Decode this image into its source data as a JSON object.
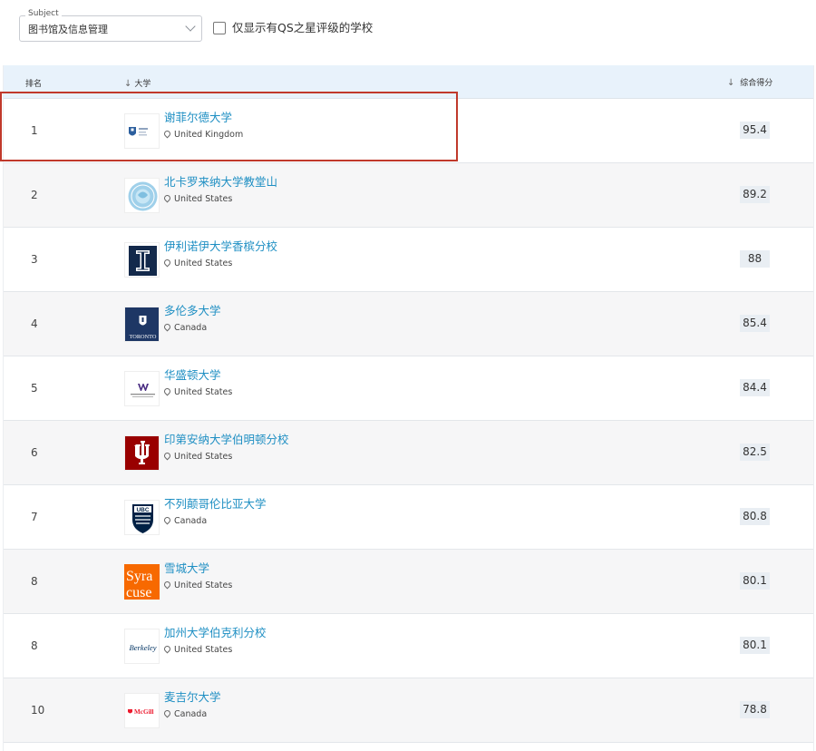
{
  "filter": {
    "subject_legend": "Subject",
    "subject_value": "图书馆及信息管理",
    "qs_stars_label": "仅显示有QS之星评级的学校"
  },
  "table": {
    "headers": {
      "rank": "排名",
      "university": "大学",
      "score": "综合得分"
    },
    "rows": [
      {
        "rank": "1",
        "name": "谢菲尔德大学",
        "country": "United Kingdom",
        "score": "95.4",
        "logo": "sheffield-logo"
      },
      {
        "rank": "2",
        "name": "北卡罗来纳大学教堂山",
        "country": "United States",
        "score": "89.2",
        "logo": "unc-seal-logo"
      },
      {
        "rank": "3",
        "name": "伊利诺伊大学香槟分校",
        "country": "United States",
        "score": "88",
        "logo": "illinois-i-logo"
      },
      {
        "rank": "4",
        "name": "多伦多大学",
        "country": "Canada",
        "score": "85.4",
        "logo": "toronto-logo"
      },
      {
        "rank": "5",
        "name": "华盛顿大学",
        "country": "United States",
        "score": "84.4",
        "logo": "uw-logo"
      },
      {
        "rank": "6",
        "name": "印第安纳大学伯明顿分校",
        "country": "United States",
        "score": "82.5",
        "logo": "indiana-logo"
      },
      {
        "rank": "7",
        "name": "不列颠哥伦比亚大学",
        "country": "Canada",
        "score": "80.8",
        "logo": "ubc-logo"
      },
      {
        "rank": "8",
        "name": "雪城大学",
        "country": "United States",
        "score": "80.1",
        "logo": "syracuse-logo"
      },
      {
        "rank": "8",
        "name": "加州大学伯克利分校",
        "country": "United States",
        "score": "80.1",
        "logo": "berkeley-logo"
      },
      {
        "rank": "10",
        "name": "麦吉尔大学",
        "country": "Canada",
        "score": "78.8",
        "logo": "mcgill-logo"
      }
    ]
  },
  "logo_text": {
    "toronto": "TORONTO",
    "ubc": "UBC",
    "syracuse_top": "Syra",
    "syracuse_bottom": "cuse",
    "berkeley": "Berkeley",
    "mcgill": "McGill"
  },
  "colors": {
    "link": "#1f8fc3",
    "header_bg": "#e8f2fb",
    "highlight": "#c0392b",
    "score_badge": "#e9eef3"
  }
}
